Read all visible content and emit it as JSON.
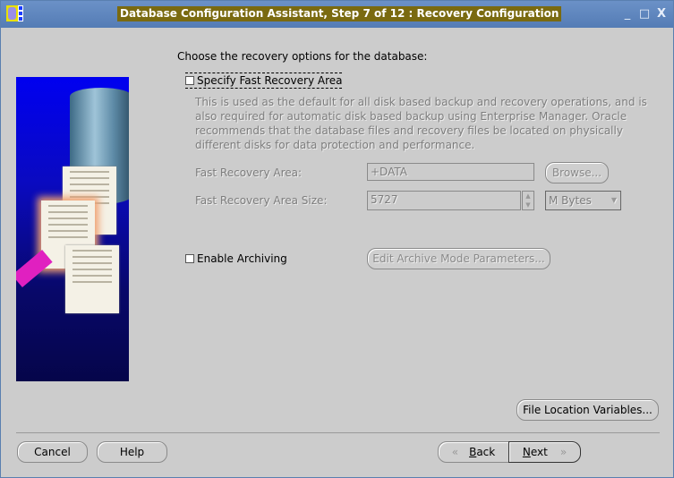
{
  "window": {
    "title": "Database Configuration Assistant, Step 7 of 12 : Recovery Configuration",
    "controls": {
      "minimize": "_",
      "maximize": "□",
      "close": "X"
    }
  },
  "main": {
    "heading": "Choose the recovery options for the database:",
    "fast_recovery": {
      "checkbox_label": "Specify Fast Recovery Area",
      "checked": false,
      "description": "This is used as the default for all disk based backup and recovery operations, and is also required for automatic disk based backup using Enterprise Manager. Oracle recommends that the database files and recovery files be located on physically different disks for data protection and performance.",
      "area_label": "Fast Recovery Area:",
      "area_value": "+DATA",
      "browse_label": "Browse...",
      "size_label": "Fast Recovery Area Size:",
      "size_value": "5727",
      "size_unit": "M Bytes"
    },
    "archiving": {
      "checkbox_label": "Enable Archiving",
      "checked": false,
      "edit_params_label": "Edit Archive Mode Parameters..."
    },
    "file_location_variables_label": "File Location Variables..."
  },
  "footer": {
    "cancel_label": "Cancel",
    "help_label": "Help",
    "back_label_prefix": "",
    "back_mnemonic": "B",
    "back_rest": "ack",
    "next_mnemonic": "N",
    "next_rest": "ext",
    "back_icon": "«",
    "next_icon": "»"
  }
}
